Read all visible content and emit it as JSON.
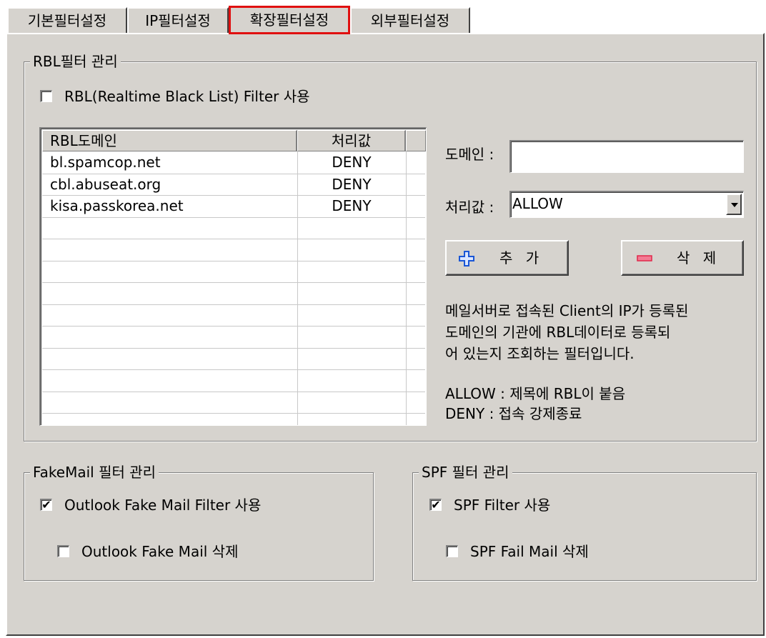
{
  "tabs": [
    "기본필터설정",
    "IP필터설정",
    "확장필터설정",
    "외부필터설정"
  ],
  "rbl": {
    "group_title": "RBL필터 관리",
    "enable_label": "RBL(Realtime Black List) Filter 사용",
    "enable_checked": false,
    "columns": [
      "RBL도메인",
      "처리값"
    ],
    "rows": [
      {
        "domain": "bl.spamcop.net",
        "action": "DENY"
      },
      {
        "domain": "cbl.abuseat.org",
        "action": "DENY"
      },
      {
        "domain": "kisa.passkorea.net",
        "action": "DENY"
      }
    ],
    "domain_label": "도메인 :",
    "domain_value": "",
    "action_label": "처리값 :",
    "action_value": "ALLOW",
    "add_label": "추 가",
    "delete_label": "삭 제",
    "desc_lines": [
      "메일서버로 접속된 Client의 IP가 등록된",
      "도메인의 기관에 RBL데이터로 등록되",
      "어 있는지 조회하는 필터입니다."
    ],
    "legend_lines": [
      "ALLOW : 제목에 RBL이 붙음",
      "DENY : 접속 강제종료"
    ]
  },
  "fakemail": {
    "group_title": "FakeMail 필터 관리",
    "filter_label": "Outlook Fake Mail Filter 사용",
    "filter_checked": true,
    "delete_label": "Outlook Fake Mail 삭제",
    "delete_checked": false
  },
  "spf": {
    "group_title": "SPF 필터 관리",
    "filter_label": "SPF Filter 사용",
    "filter_checked": true,
    "delete_label": "SPF Fail Mail 삭제",
    "delete_checked": false
  },
  "colors": {
    "active_tab_outline": "#e01010",
    "dialog_bg": "#d6d3ce",
    "add_icon": "#1a56d6",
    "delete_icon": "#e0284a"
  },
  "icons": {
    "add": "plus-icon",
    "delete": "minus-icon",
    "dropdown": "chevron-down-icon",
    "check": "checkmark-icon"
  }
}
